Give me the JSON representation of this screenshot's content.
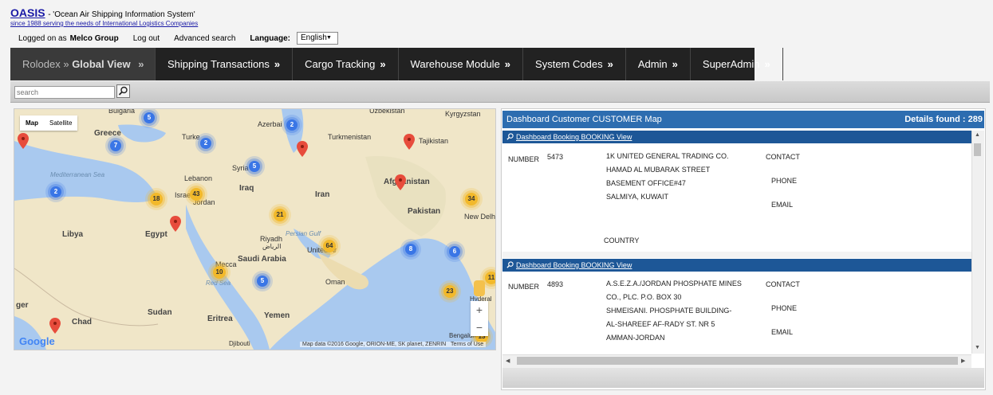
{
  "header": {
    "app_name": "OASIS",
    "tagline": "- 'Ocean Air Shipping Information System'",
    "since": "since 1988 serving the needs of International Logistics Companies",
    "logged_on_prefix": "Logged on as",
    "user": "Melco Group",
    "logout": "Log out",
    "advanced_search": "Advanced search",
    "language_label": "Language:",
    "language_value": "English"
  },
  "nav": {
    "items": [
      {
        "prefix": "Rolodex",
        "label": "Global View"
      },
      {
        "label": "Shipping Transactions"
      },
      {
        "label": "Cargo Tracking"
      },
      {
        "label": "Warehouse Module"
      },
      {
        "label": "System Codes"
      },
      {
        "label": "Admin"
      },
      {
        "label": "SuperAdmin"
      }
    ],
    "separator": "»"
  },
  "search": {
    "placeholder": "search"
  },
  "map": {
    "type_buttons": [
      "Map",
      "Satellite"
    ],
    "places": [
      "Bulgaria",
      "Azerbai",
      "Kyrgyzstan",
      "Uzbekistan",
      "Greece",
      "Turke",
      "Turkmenistan",
      "Tajikistan",
      "Lebanon",
      "Syria",
      "Iraq",
      "Iran",
      "Afghanistan",
      "Israel",
      "Jordan",
      "Pakistan",
      "New Delhi",
      "Libya",
      "Egypt",
      "Riyadh",
      "Persian Gulf",
      "Saudi Arabia",
      "United Ar",
      "Mecca",
      "Red Sea",
      "Oman",
      "Sudan",
      "Eritrea",
      "Yemen",
      "Chad",
      "Djibouti",
      "Bengaluru",
      "Hyderal",
      "ger",
      "Mediterranean Sea"
    ],
    "place_arabic": "الرياض",
    "clusters": [
      {
        "n": "5"
      },
      {
        "n": "2"
      },
      {
        "n": "7"
      },
      {
        "n": "2"
      },
      {
        "n": "5"
      },
      {
        "n": "2"
      },
      {
        "n": "18"
      },
      {
        "n": "43"
      },
      {
        "n": "21"
      },
      {
        "n": "34"
      },
      {
        "n": "64"
      },
      {
        "n": "8"
      },
      {
        "n": "6"
      },
      {
        "n": "10"
      },
      {
        "n": "5"
      },
      {
        "n": "23"
      },
      {
        "n": "11"
      },
      {
        "n": "13"
      }
    ],
    "zoom_in": "+",
    "zoom_out": "−",
    "google": "Google",
    "attribution": "Map data ©2016 Google, ORION-ME, SK planet, ZENRIN",
    "terms": "Terms of Use"
  },
  "panel": {
    "title": "Dashboard Customer CUSTOMER Map",
    "details": "Details found : 289",
    "records": [
      {
        "head": "Dashboard Booking BOOKING View",
        "number_label": "NUMBER",
        "number": "5473",
        "address": [
          "1K UNITED GENERAL TRADING CO.",
          "HAMAD AL MUBARAK STREET",
          "BASEMENT OFFICE#47",
          "SALMIYA, KUWAIT"
        ],
        "contact": "CONTACT",
        "phone": "PHONE",
        "email": "EMAIL",
        "country": "COUNTRY"
      },
      {
        "head": "Dashboard Booking BOOKING View",
        "number_label": "NUMBER",
        "number": "4893",
        "address": [
          "A.S.E.Z.A./JORDAN PHOSPHATE MINES",
          "CO., PLC. P.O. BOX 30",
          "SHMEISANI. PHOSPHATE BUILDING-",
          "AL-SHAREEF AF-RADY ST. NR 5",
          "AMMAN-JORDAN"
        ],
        "contact": "CONTACT",
        "phone": "PHONE",
        "email": "EMAIL"
      }
    ]
  }
}
